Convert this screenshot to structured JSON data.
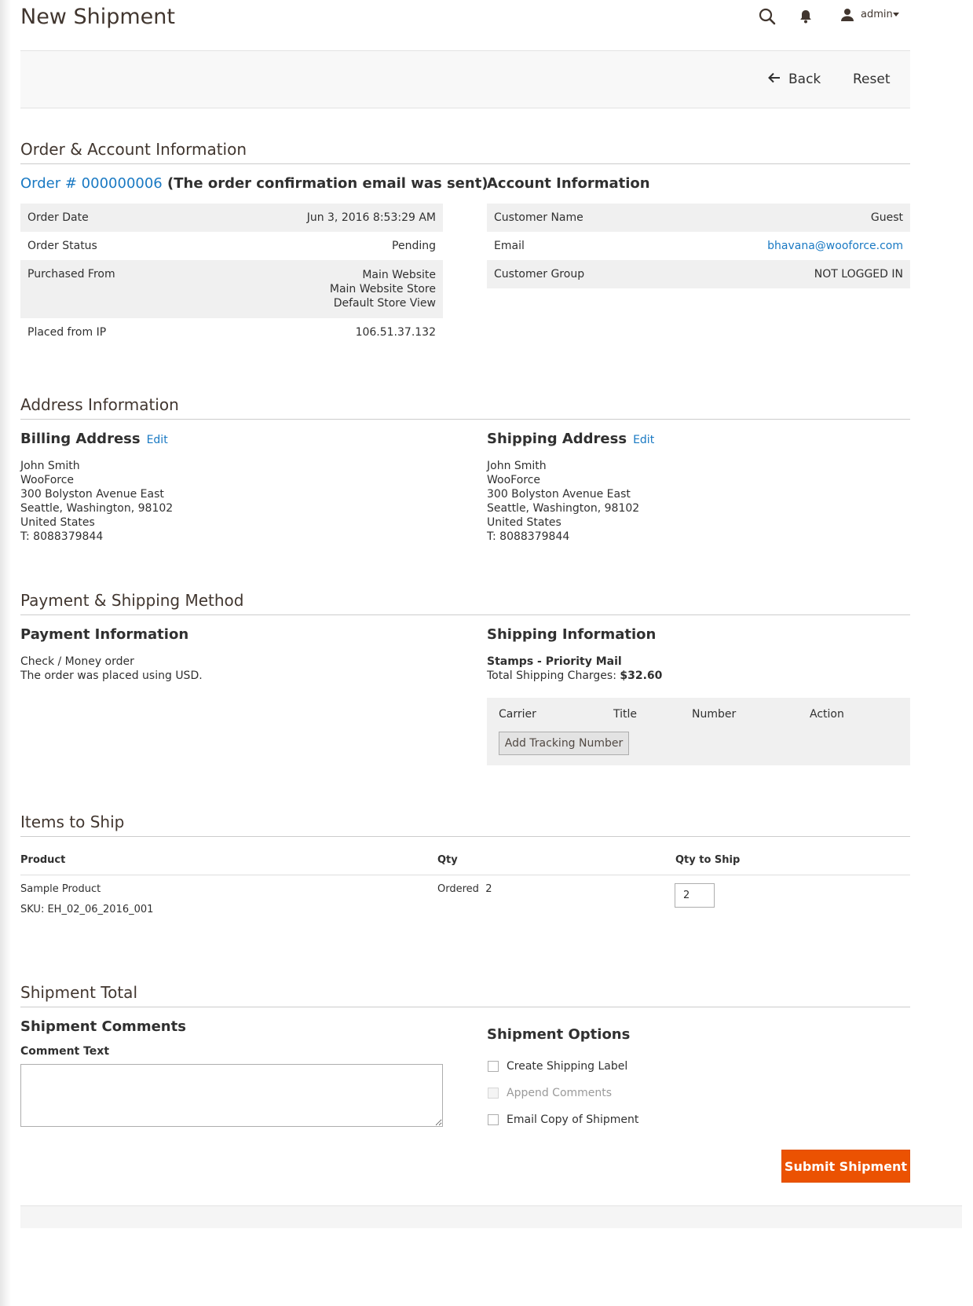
{
  "page": {
    "title": "New Shipment"
  },
  "header": {
    "user": "admin"
  },
  "actions": {
    "back": "Back",
    "reset": "Reset"
  },
  "order_section": {
    "title": "Order & Account Information",
    "order_link": "Order # 000000006",
    "order_note": "(The order confirmation email was sent)",
    "rows": [
      {
        "label": "Order Date",
        "value": "Jun 3, 2016 8:53:29 AM"
      },
      {
        "label": "Order Status",
        "value": "Pending"
      },
      {
        "label": "Purchased From",
        "value_lines": [
          "Main Website",
          "Main Website Store",
          "Default Store View"
        ]
      },
      {
        "label": "Placed from IP",
        "value": "106.51.37.132"
      }
    ]
  },
  "account": {
    "title": "Account Information",
    "rows": [
      {
        "label": "Customer Name",
        "value": "Guest"
      },
      {
        "label": "Email",
        "value": "bhavana@wooforce.com"
      },
      {
        "label": "Customer Group",
        "value": "NOT LOGGED IN"
      }
    ]
  },
  "address_section": {
    "title": "Address Information",
    "edit_label": "Edit",
    "billing": {
      "title": "Billing Address",
      "lines": [
        "John Smith",
        "WooForce",
        "300 Bolyston Avenue East",
        "Seattle, Washington, 98102",
        "United States",
        "T: 8088379844"
      ]
    },
    "shipping": {
      "title": "Shipping Address",
      "lines": [
        "John Smith",
        "WooForce",
        "300 Bolyston Avenue East",
        "Seattle, Washington, 98102",
        "United States",
        "T: 8088379844"
      ]
    }
  },
  "payment_section": {
    "title": "Payment & Shipping Method",
    "payment": {
      "title": "Payment Information",
      "method": "Check / Money order",
      "note": "The order was placed using USD."
    },
    "shipping": {
      "title": "Shipping Information",
      "method": "Stamps - Priority Mail",
      "charges_label": "Total Shipping Charges:",
      "charges_value": "$32.60"
    },
    "tracking": {
      "headers": [
        "Carrier",
        "Title",
        "Number",
        "Action"
      ],
      "add_button": "Add Tracking Number"
    }
  },
  "items_section": {
    "title": "Items to Ship",
    "headers": {
      "product": "Product",
      "qty": "Qty",
      "qty_to_ship": "Qty to Ship"
    },
    "rows": [
      {
        "product": "Sample Product",
        "sku": "SKU: EH_02_06_2016_001",
        "qty_ordered_label": "Ordered",
        "qty_ordered": "2",
        "qty_to_ship": "2"
      }
    ]
  },
  "total_section": {
    "title": "Shipment Total",
    "comments_title": "Shipment Comments",
    "comment_label": "Comment Text",
    "comment_value": "",
    "options_title": "Shipment Options",
    "options": [
      {
        "label": "Create Shipping Label",
        "checked": false,
        "disabled": false
      },
      {
        "label": "Append Comments",
        "checked": false,
        "disabled": true
      },
      {
        "label": "Email Copy of Shipment",
        "checked": false,
        "disabled": false
      }
    ],
    "submit": "Submit Shipment"
  },
  "colors": {
    "accent": "#eb5202",
    "link": "#1979c3",
    "text": "#303030"
  }
}
